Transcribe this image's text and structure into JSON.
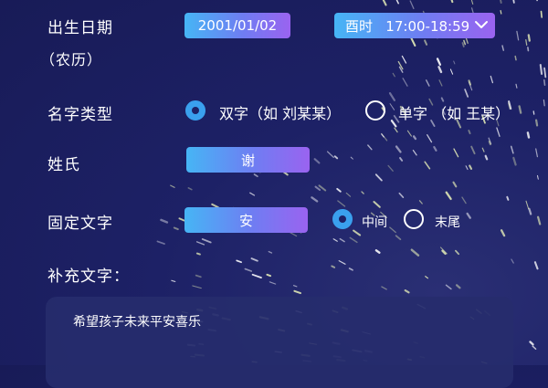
{
  "birth": {
    "label": "出生日期",
    "sublabel": "（农历）",
    "date_value": "2001/01/02",
    "time_value": "酉时   17:00-18:59",
    "time_icon": "chevron-down-icon"
  },
  "name_type": {
    "label": "名字类型",
    "options": [
      {
        "label": "双字（如 刘某某）",
        "selected": true
      },
      {
        "label": "单字 （如 王某）",
        "selected": false
      }
    ]
  },
  "surname": {
    "label": "姓氏",
    "value": "谢"
  },
  "fixed_char": {
    "label": "固定文字",
    "value": "安",
    "positions": [
      {
        "label": "中间",
        "selected": true
      },
      {
        "label": "末尾",
        "selected": false
      }
    ]
  },
  "extra": {
    "label": "补充文字：",
    "value": "希望孩子未来平安喜乐"
  },
  "colors": {
    "background": "#1d2166",
    "accent_from": "#46b5f5",
    "accent_to": "#9a63f0",
    "radio_selected": "#3aa0ee"
  }
}
